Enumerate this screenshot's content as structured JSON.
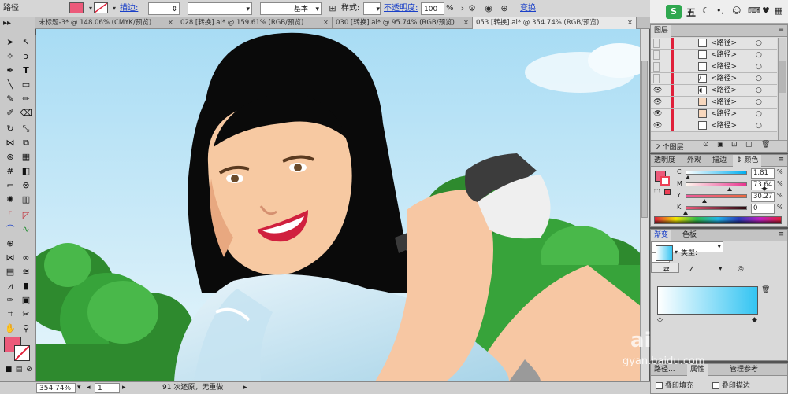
{
  "control_bar": {
    "object_type": "路径",
    "stroke_label": "描边:",
    "brush_label": "基本",
    "style_label": "样式:",
    "opacity_label": "不透明度:",
    "opacity_value": "100",
    "opacity_unit": "%",
    "transform_label": "变换",
    "fill_color": "#ec5a7a"
  },
  "document_tabs": [
    {
      "label": "未标题-3* @ 148.06% (CMYK/预览)",
      "active": false
    },
    {
      "label": "028 [转换].ai* @ 159.61% (RGB/预览)",
      "active": false
    },
    {
      "label": "030 [转换].ai* @ 95.74% (RGB/预览)",
      "active": false
    },
    {
      "label": "053 [转换].ai* @ 354.74% (RGB/预览)",
      "active": true
    }
  ],
  "tab_close": "×",
  "ime_bar": {
    "label": "五"
  },
  "layers_panel": {
    "title": "图层",
    "items": [
      "<路径>",
      "<路径>",
      "<路径>",
      "<路径>",
      "<路径>",
      "<路径>",
      "<路径>",
      "<路径>"
    ],
    "footer": "2 个图层"
  },
  "color_panel": {
    "tabs": [
      "透明度",
      "外观",
      "描边",
      "颜色"
    ],
    "active_tab": "颜色",
    "channels": [
      {
        "name": "C",
        "value": "1.81",
        "unit": "%"
      },
      {
        "name": "M",
        "value": "73.64",
        "unit": "%"
      },
      {
        "name": "Y",
        "value": "30.27",
        "unit": "%"
      },
      {
        "name": "K",
        "value": "0",
        "unit": "%"
      }
    ],
    "fill_color": "#ec5a7a",
    "stroke_color": "#ec3f55"
  },
  "gradient_panel": {
    "tabs": [
      "渐变",
      "色板"
    ],
    "type_label": "类型:",
    "stop_left": "#ffffff",
    "stop_right": "#33c4f2"
  },
  "bottom_panel": {
    "tabs": [
      "路径...",
      "属性",
      "管理参考"
    ],
    "overprint_fill": "叠印填充",
    "overprint_stroke": "叠印描边"
  },
  "status_bar": {
    "zoom": "354.74%",
    "page": "1",
    "info": "91 次还原，无重做"
  },
  "watermark": "gyan.baidu.com"
}
